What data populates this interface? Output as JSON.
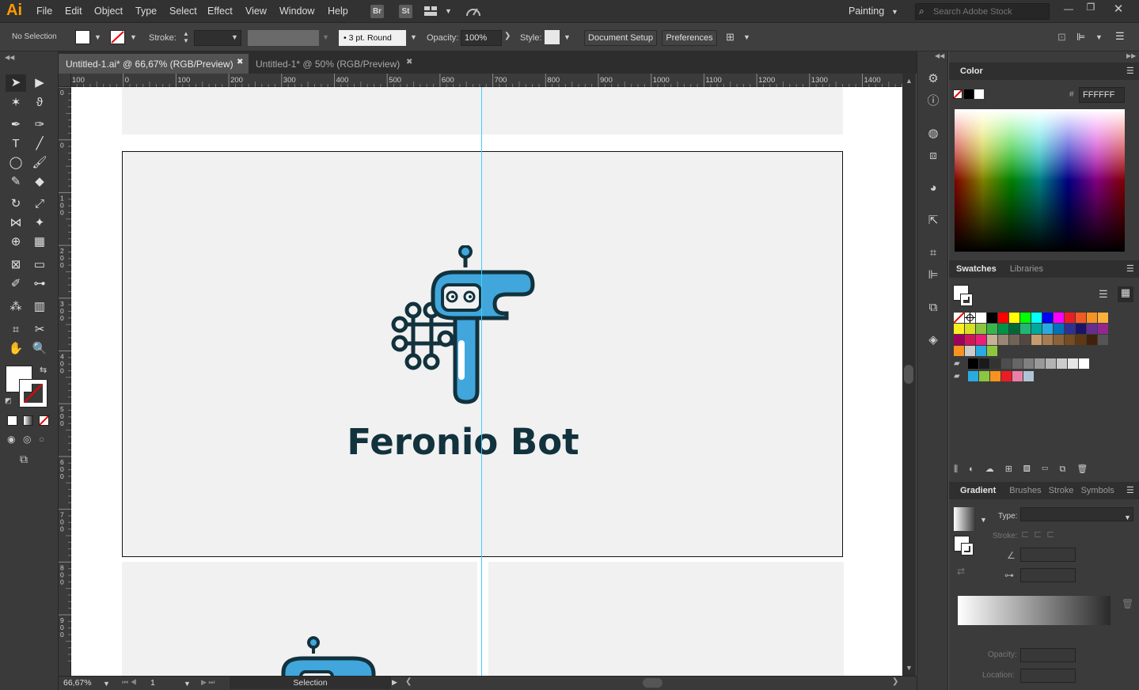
{
  "app": {
    "logo": "Ai"
  },
  "menu": {
    "items": [
      "File",
      "Edit",
      "Object",
      "Type",
      "Select",
      "Effect",
      "View",
      "Window",
      "Help"
    ]
  },
  "bridge": {
    "br": "Br",
    "st": "St"
  },
  "workspace": {
    "label": "Painting"
  },
  "search": {
    "placeholder": "Search Adobe Stock"
  },
  "control": {
    "selection": "No Selection",
    "stroke_label": "Stroke:",
    "brush": "3 pt. Round",
    "opacity_label": "Opacity:",
    "opacity_value": "100%",
    "style_label": "Style:",
    "doc_setup": "Document Setup",
    "preferences": "Preferences"
  },
  "tabs": [
    {
      "label": "Untitled-1.ai* @ 66,67% (RGB/Preview)",
      "active": true
    },
    {
      "label": "Untitled-1* @ 50% (RGB/Preview)",
      "active": false
    }
  ],
  "ruler": {
    "h_ticks": [
      "100",
      "0",
      "100",
      "200",
      "300",
      "400",
      "500",
      "600",
      "700",
      "800",
      "900",
      "1000",
      "1100",
      "1200",
      "1300",
      "1400"
    ],
    "v_ticks": [
      "0",
      "0",
      "1\n0\n0",
      "2\n0\n0",
      "3\n0\n0",
      "4\n0\n0",
      "5\n0\n0",
      "6\n0\n0",
      "7\n0\n0",
      "8\n0\n0",
      "9\n0\n0"
    ]
  },
  "artboard": {
    "logo_text": "Feronio Bot"
  },
  "status": {
    "zoom": "66,67%",
    "page": "1",
    "tool": "Selection"
  },
  "color_panel": {
    "title": "Color",
    "hex": "FFFFFF"
  },
  "swatches_panel": {
    "tab1": "Swatches",
    "tab2": "Libraries"
  },
  "gradient_panel": {
    "tab1": "Gradient",
    "tab2": "Brushes",
    "tab3": "Stroke",
    "tab4": "Symbols",
    "type_label": "Type:",
    "stroke_label": "Stroke:",
    "opacity_label": "Opacity:",
    "location_label": "Location:"
  },
  "colors": {
    "accent": "#ff9a00",
    "guide": "#3fd0ff",
    "bot_blue": "#41a6dc",
    "bot_dark": "#12323d"
  },
  "swatch_rows": [
    [
      "none",
      "reg",
      "#ffffff",
      "#000000",
      "#ff0000",
      "#ffff00",
      "#00ff00",
      "#00ffff",
      "#0000ff",
      "#ff00ff",
      "#ed1c24",
      "#f15a24",
      "#f7931e",
      "#fbb03b"
    ],
    [
      "#fcee21",
      "#d9e021",
      "#8cc63f",
      "#39b54a",
      "#009245",
      "#006837",
      "#22b573",
      "#00a99d",
      "#29abe2",
      "#0071bc",
      "#2e3192",
      "#1b1464",
      "#662d91",
      "#93278f"
    ],
    [
      "#9e005d",
      "#d4145a",
      "#ed1e79",
      "#c7b299",
      "#998675",
      "#736357",
      "#534741",
      "#c69c6d",
      "#a67c52",
      "#8c6239",
      "#754c24",
      "#603813",
      "#42210b",
      "#555555"
    ],
    [
      "#f7931e",
      "#cccccc",
      "#29abe2",
      "#8cc63f"
    ],
    [
      "#000000",
      "#1a1a1a",
      "#333333",
      "#4d4d4d",
      "#666666",
      "#808080",
      "#999999",
      "#b3b3b3",
      "#cccccc",
      "#e6e6e6",
      "#ffffff"
    ],
    [
      "#29abe2",
      "#8cc63f",
      "#f7931e",
      "#ed1c24",
      "#ed7fa6",
      "#b0c4d6"
    ]
  ]
}
